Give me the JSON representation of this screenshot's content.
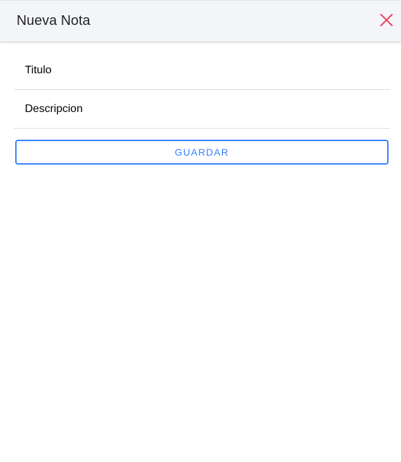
{
  "header": {
    "title": "Nueva Nota",
    "close_icon": "close-icon"
  },
  "form": {
    "title_field": {
      "placeholder": "Titulo",
      "value": ""
    },
    "description_field": {
      "placeholder": "Descripcion",
      "value": ""
    },
    "save_label": "GUARDAR"
  },
  "colors": {
    "header_bg": "#f4f5f8",
    "accent": "#3880ff",
    "close_icon": "#eb445a",
    "divider": "#dedede"
  }
}
